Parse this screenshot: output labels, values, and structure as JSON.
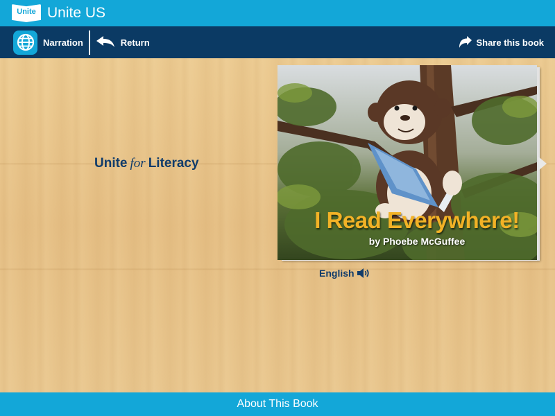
{
  "header": {
    "logo_text": "Unite",
    "app_title": "Unite US"
  },
  "toolbar": {
    "narration_label": "Narration",
    "return_label": "Return",
    "share_label": "Share this book"
  },
  "main": {
    "brand": {
      "part1": "Unite",
      "part2": "for",
      "part3": "Literacy"
    },
    "book": {
      "title": "I Read Everywhere!",
      "author": "by Phoebe McGuffee"
    },
    "language_label": "English"
  },
  "footer": {
    "about_label": "About This Book"
  },
  "icons": {
    "logo": "book-logo-icon",
    "narration": "globe-icon",
    "return": "return-arrow-icon",
    "share": "share-arrow-icon",
    "audio": "speaker-icon",
    "next": "next-page-arrow-icon"
  },
  "colors": {
    "top_bar": "#13a7d8",
    "nav_bar": "#0b3a64",
    "brand_text": "#113c6a",
    "title_text": "#f2b226"
  }
}
